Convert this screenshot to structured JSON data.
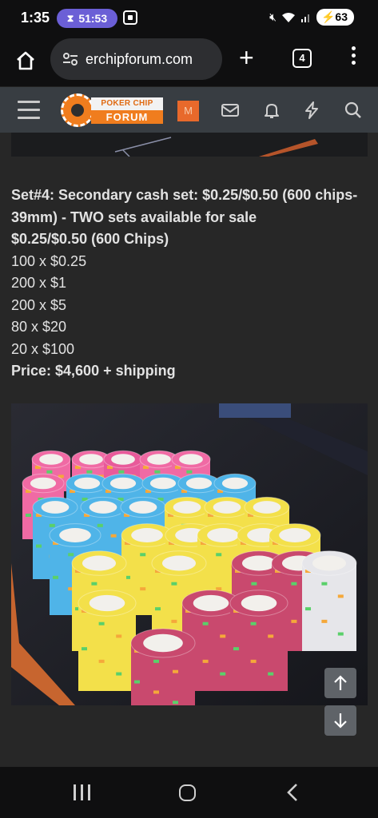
{
  "status": {
    "time": "1:35",
    "timer": "51:53",
    "battery": "63"
  },
  "browser": {
    "url": "erchipforum.com",
    "tab_count": "4"
  },
  "forum": {
    "logo_top": "POKER CHIP",
    "logo_bottom": "FORUM",
    "avatar_letter": "M"
  },
  "post": {
    "title": "Set#4: Secondary cash set: $0.25/$0.50 (600 chips-39mm) - TWO sets available for sale",
    "subtitle": "$0.25/$0.50 (600 Chips)",
    "lines": [
      "100 x $0.25",
      "200 x $1",
      "200 x $5",
      "80 x $20",
      "20 x $100"
    ],
    "price": "Price: $4,600 + shipping"
  },
  "colors": {
    "status_bg": "#0f0f10",
    "forum_header_bg": "#383d42",
    "page_bg": "#272727",
    "accent_orange": "#f07d1e",
    "timer_pill": "#6b5fd6"
  },
  "icons": [
    "home-icon",
    "site-settings-icon",
    "new-tab-icon",
    "tab-switcher-icon",
    "more-menu-icon",
    "hamburger-menu-icon",
    "inbox-icon",
    "bell-icon",
    "bolt-icon",
    "search-icon",
    "arrow-up-icon",
    "arrow-down-icon",
    "recents-icon",
    "home-nav-icon",
    "back-icon"
  ]
}
